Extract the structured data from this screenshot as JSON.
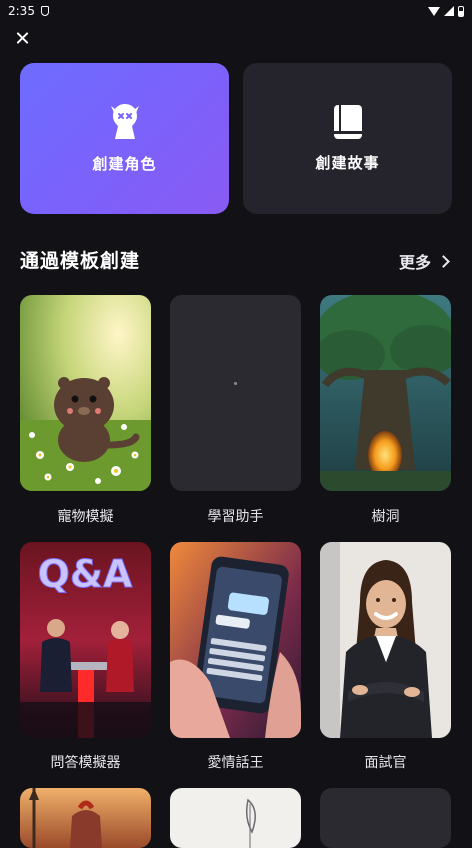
{
  "status_bar": {
    "time": "2:35"
  },
  "create_options": [
    {
      "label": "創建角色",
      "icon": "character-icon",
      "accent": "#7466fb"
    },
    {
      "label": "創建故事",
      "icon": "book-icon",
      "accent": "#25232b"
    }
  ],
  "templates_section": {
    "title": "通過模板創建",
    "more_label": "更多"
  },
  "templates": [
    {
      "label": "寵物模擬",
      "image": "cute brown bear-like pet in flowery meadow"
    },
    {
      "label": "學習助手",
      "image": "blank dark card"
    },
    {
      "label": "樹洞",
      "image": "giant tree with glowing hollow"
    },
    {
      "label": "問答模擬器",
      "image": "Q&A quiz show stage with two people"
    },
    {
      "label": "愛情話王",
      "image": "hand holding smartphone with chat"
    },
    {
      "label": "面試官",
      "image": "smiling businesswoman with crossed arms"
    }
  ],
  "qa_sign_text": "Q&A"
}
